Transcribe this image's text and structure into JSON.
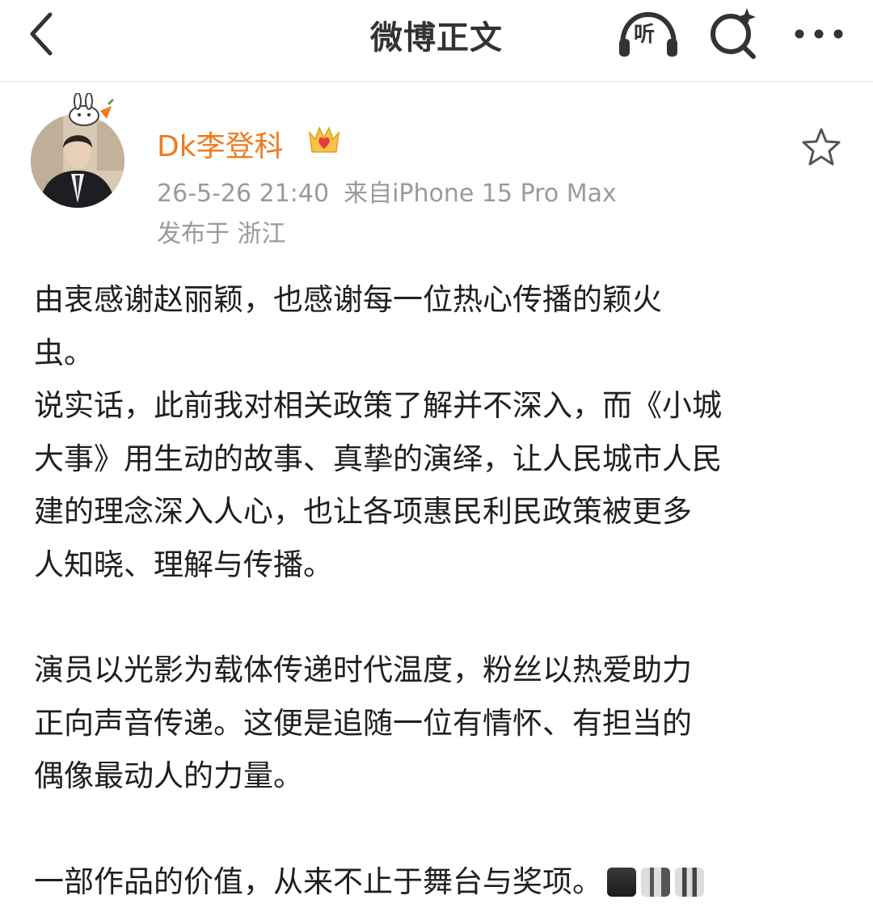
{
  "header": {
    "title": "微博正文",
    "listen_label": "听"
  },
  "author": {
    "name": "Dk李登科",
    "time": "26-5-26 21:40",
    "source": "来自iPhone 15 Pro Max",
    "location": "发布于 浙江"
  },
  "post": {
    "paragraphs": [
      [
        "由衷感谢赵丽颖，也感谢每一位热心传播的颖火",
        "虫。",
        "说实话，此前我对相关政策了解并不深入，而《小城",
        "大事》用生动的故事、真挚的演绎，让人民城市人民",
        "建的理念深入人心，也让各项惠民利民政策被更多",
        "人知晓、理解与传播。"
      ],
      [
        "演员以光影为载体传递时代温度，粉丝以热爱助力",
        "正向声音传递。这便是追随一位有情怀、有担当的",
        "偶像最动人的力量。"
      ],
      [
        "一部作品的价值，从来不止于舞台与奖项。"
      ]
    ]
  },
  "colors": {
    "author_name": "#f07a1d",
    "meta_text": "#9a9a9a",
    "body_text": "#1f1f1f",
    "icon": "#333333"
  },
  "icons": {
    "back": "chevron-left-icon",
    "listen": "headphones-icon",
    "search": "search-sparkle-icon",
    "more": "more-dots-icon",
    "favorite": "star-outline-icon",
    "badge": "crown-heart-icon"
  }
}
